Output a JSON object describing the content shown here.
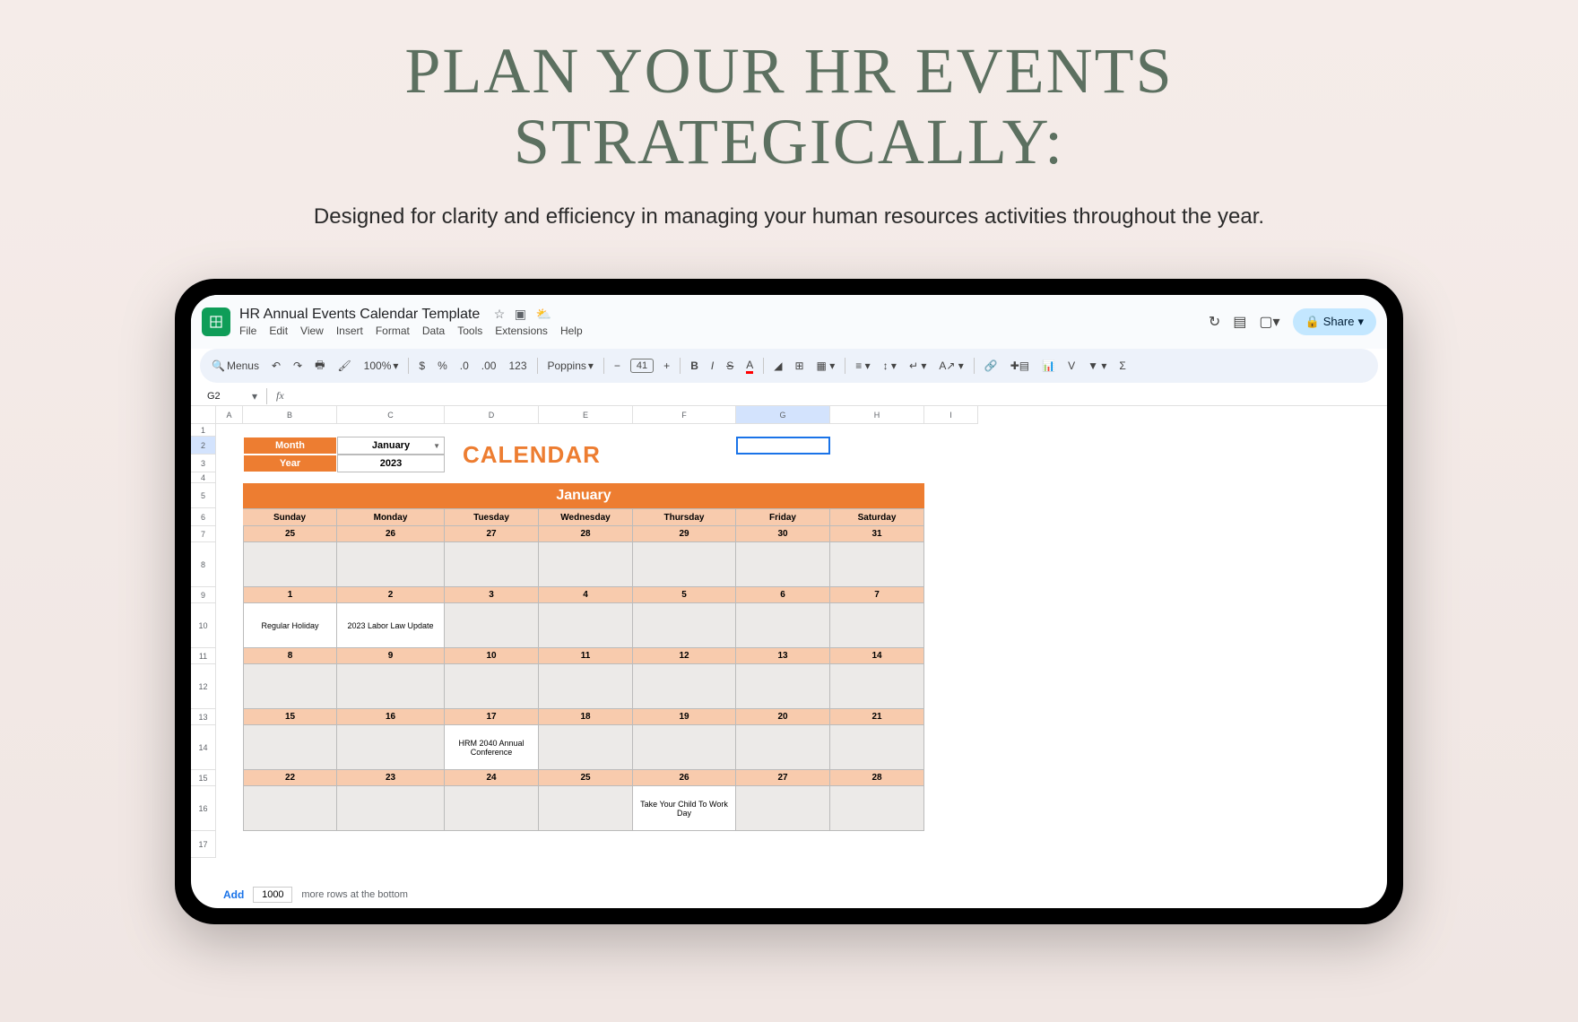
{
  "promo": {
    "title_line1": "PLAN YOUR HR EVENTS",
    "title_line2": "STRATEGICALLY:",
    "subtitle": "Designed for clarity and efficiency in managing your human resources activities throughout the year."
  },
  "doc": {
    "title": "HR Annual Events Calendar Template",
    "menus": [
      "File",
      "Edit",
      "View",
      "Insert",
      "Format",
      "Data",
      "Tools",
      "Extensions",
      "Help"
    ],
    "share_label": "Share"
  },
  "toolbar": {
    "search_label": "Menus",
    "zoom": "100%",
    "currency": "$",
    "percent": "%",
    "dec_dec": ".0",
    "dec_inc": ".00",
    "num_fmt": "123",
    "font": "Poppins",
    "font_size": "41"
  },
  "fx": {
    "cell": "G2"
  },
  "columns": [
    "A",
    "B",
    "C",
    "D",
    "E",
    "F",
    "G",
    "H",
    "I"
  ],
  "row_nums": [
    "1",
    "2",
    "3",
    "4",
    "5",
    "6",
    "7",
    "8",
    "9",
    "10",
    "11",
    "12",
    "13",
    "14",
    "15",
    "16",
    "17"
  ],
  "inputs": {
    "month_label": "Month",
    "month_value": "January",
    "year_label": "Year",
    "year_value": "2023"
  },
  "calendar": {
    "title": "CALENDAR",
    "month_name": "January",
    "day_headers": [
      "Sunday",
      "Monday",
      "Tuesday",
      "Wednesday",
      "Thursday",
      "Friday",
      "Saturday"
    ],
    "weeks": [
      {
        "dates": [
          "25",
          "26",
          "27",
          "28",
          "29",
          "30",
          "31"
        ],
        "events": [
          "",
          "",
          "",
          "",
          "",
          "",
          ""
        ]
      },
      {
        "dates": [
          "1",
          "2",
          "3",
          "4",
          "5",
          "6",
          "7"
        ],
        "events": [
          "Regular Holiday",
          "2023 Labor Law Update",
          "",
          "",
          "",
          "",
          ""
        ]
      },
      {
        "dates": [
          "8",
          "9",
          "10",
          "11",
          "12",
          "13",
          "14"
        ],
        "events": [
          "",
          "",
          "",
          "",
          "",
          "",
          ""
        ]
      },
      {
        "dates": [
          "15",
          "16",
          "17",
          "18",
          "19",
          "20",
          "21"
        ],
        "events": [
          "",
          "",
          "HRM 2040 Annual Conference",
          "",
          "",
          "",
          ""
        ]
      },
      {
        "dates": [
          "22",
          "23",
          "24",
          "25",
          "26",
          "27",
          "28"
        ],
        "events": [
          "",
          "",
          "",
          "",
          "Take Your Child To Work Day",
          "",
          ""
        ]
      }
    ]
  },
  "footer": {
    "add": "Add",
    "rows": "1000",
    "text": "more rows at the bottom"
  }
}
